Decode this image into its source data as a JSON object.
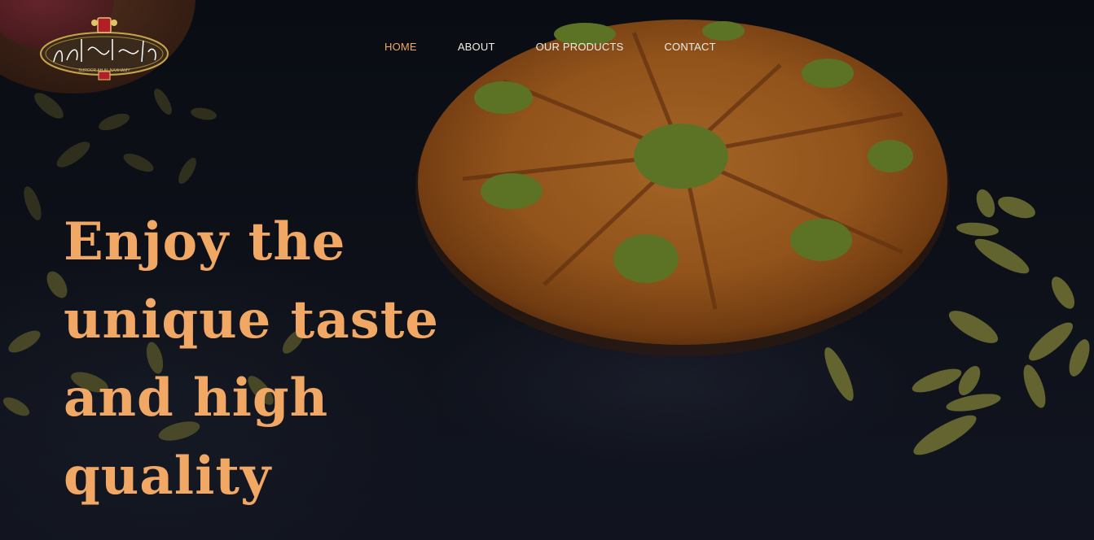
{
  "brand": {
    "logo_icon": "brand-logo-emblem",
    "logo_text_latin": "SUROOR AH AL NAHHAMY"
  },
  "nav": {
    "items": [
      {
        "label": "HOME",
        "active": true
      },
      {
        "label": "ABOUT",
        "active": false
      },
      {
        "label": "OUR PRODUCTS",
        "active": false
      },
      {
        "label": "CONTACT",
        "active": false
      }
    ]
  },
  "hero": {
    "headline_lines": [
      "Enjoy the",
      "unique taste",
      "and high",
      "quality"
    ]
  },
  "colors": {
    "accent": "#f1a865",
    "nav_text": "#f1ece4",
    "background": "#0d0f16"
  }
}
